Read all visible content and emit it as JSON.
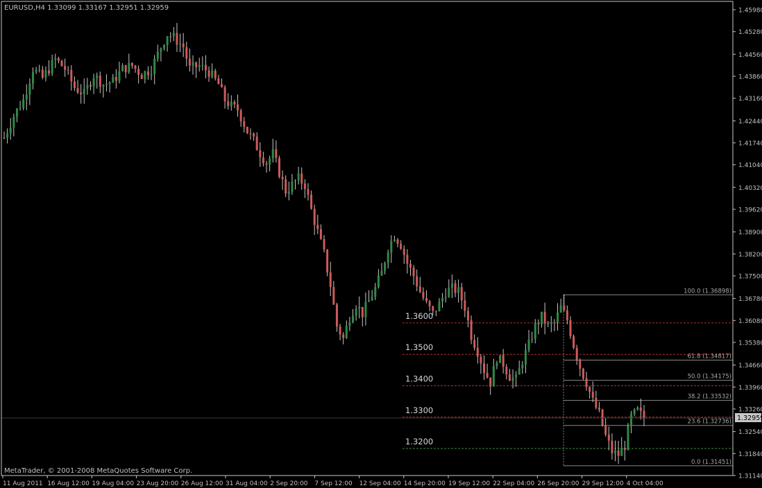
{
  "symbol_header": "EURUSD,H4  1.33099 1.33167 1.32951 1.32959",
  "footer": "MetaTrader, © 2001-2008 MetaQuotes Software Corp.",
  "colors": {
    "background": "#000000",
    "frame": "#c8c8c8",
    "bull": "#2e8b46",
    "bear": "#d05a5a",
    "wick": "#c8c8c8",
    "grid": "#1a1a1a",
    "level_red": "#b03030",
    "level_green": "#3c8c3c",
    "fib": "#8a8a8a",
    "text": "#c0c0c0",
    "current_price_bg": "#c8c8c8"
  },
  "chart_data": {
    "type": "candlestick",
    "timeframe": "H4",
    "ylim": [
      1.3114,
      1.4598
    ],
    "y_ticks": [
      "1.45980",
      "1.45280",
      "1.44560",
      "1.43860",
      "1.43160",
      "1.42440",
      "1.41740",
      "1.41040",
      "1.40320",
      "1.39620",
      "1.38900",
      "1.38200",
      "1.37500",
      "1.36780",
      "1.36080",
      "1.35380",
      "1.34660",
      "1.33960",
      "1.33260",
      "1.32540",
      "1.31840",
      "1.31140"
    ],
    "x_ticks": [
      "11 Aug 2011",
      "16 Aug 12:00",
      "19 Aug 04:00",
      "23 Aug 20:00",
      "26 Aug 12:00",
      "31 Aug 04:00",
      "2 Sep 20:00",
      "7 Sep 12:00",
      "12 Sep 04:00",
      "14 Sep 20:00",
      "19 Sep 12:00",
      "22 Sep 04:00",
      "26 Sep 20:00",
      "29 Sep 12:00",
      "4 Oct 04:00"
    ],
    "current_price": "1.32959",
    "current_price_value": 1.32959,
    "anchors": [
      [
        0,
        1.419
      ],
      [
        3,
        1.426
      ],
      [
        6,
        1.431
      ],
      [
        9,
        1.441
      ],
      [
        12,
        1.438
      ],
      [
        16,
        1.444
      ],
      [
        19,
        1.441
      ],
      [
        22,
        1.435
      ],
      [
        25,
        1.433
      ],
      [
        28,
        1.439
      ],
      [
        31,
        1.436
      ],
      [
        34,
        1.437
      ],
      [
        37,
        1.441
      ],
      [
        40,
        1.442
      ],
      [
        43,
        1.439
      ],
      [
        46,
        1.441
      ],
      [
        49,
        1.448
      ],
      [
        51,
        1.452
      ],
      [
        53,
        1.451
      ],
      [
        56,
        1.448
      ],
      [
        58,
        1.441
      ],
      [
        61,
        1.442
      ],
      [
        64,
        1.44
      ],
      [
        67,
        1.436
      ],
      [
        69,
        1.431
      ],
      [
        71,
        1.429
      ],
      [
        73,
        1.428
      ],
      [
        76,
        1.421
      ],
      [
        78,
        1.418
      ],
      [
        80,
        1.414
      ],
      [
        82,
        1.411
      ],
      [
        84,
        1.414
      ],
      [
        86,
        1.408
      ],
      [
        88,
        1.402
      ],
      [
        90,
        1.404
      ],
      [
        92,
        1.406
      ],
      [
        94,
        1.404
      ],
      [
        96,
        1.396
      ],
      [
        98,
        1.389
      ],
      [
        100,
        1.382
      ],
      [
        102,
        1.372
      ],
      [
        104,
        1.359
      ],
      [
        106,
        1.355
      ],
      [
        108,
        1.362
      ],
      [
        110,
        1.366
      ],
      [
        112,
        1.363
      ],
      [
        114,
        1.367
      ],
      [
        116,
        1.371
      ],
      [
        118,
        1.376
      ],
      [
        120,
        1.384
      ],
      [
        122,
        1.388
      ],
      [
        124,
        1.385
      ],
      [
        126,
        1.379
      ],
      [
        128,
        1.375
      ],
      [
        130,
        1.37
      ],
      [
        132,
        1.366
      ],
      [
        134,
        1.363
      ],
      [
        136,
        1.366
      ],
      [
        138,
        1.37
      ],
      [
        140,
        1.371
      ],
      [
        142,
        1.37
      ],
      [
        144,
        1.365
      ],
      [
        146,
        1.356
      ],
      [
        148,
        1.351
      ],
      [
        150,
        1.345
      ],
      [
        152,
        1.341
      ],
      [
        154,
        1.349
      ],
      [
        156,
        1.347
      ],
      [
        158,
        1.343
      ],
      [
        160,
        1.342
      ],
      [
        162,
        1.348
      ],
      [
        164,
        1.353
      ],
      [
        166,
        1.359
      ],
      [
        168,
        1.362
      ],
      [
        170,
        1.359
      ],
      [
        172,
        1.36
      ],
      [
        174,
        1.365
      ],
      [
        176,
        1.361
      ],
      [
        178,
        1.353
      ],
      [
        180,
        1.346
      ],
      [
        182,
        1.341
      ],
      [
        184,
        1.335
      ],
      [
        186,
        1.331
      ],
      [
        188,
        1.324
      ],
      [
        190,
        1.319
      ],
      [
        192,
        1.318
      ],
      [
        194,
        1.321
      ],
      [
        196,
        1.33
      ],
      [
        198,
        1.332
      ],
      [
        200,
        1.3296
      ]
    ],
    "horizontal_levels": [
      {
        "label": "1.3600",
        "value": 1.36,
        "color": "red"
      },
      {
        "label": "1.3500",
        "value": 1.35,
        "color": "red"
      },
      {
        "label": "1.3400",
        "value": 1.34,
        "color": "red"
      },
      {
        "label": "1.3300",
        "value": 1.33,
        "color": "red"
      },
      {
        "label": "1.3200",
        "value": 1.32,
        "color": "green"
      }
    ],
    "fibonacci": [
      {
        "label": "100.0 (1.36898)",
        "value": 1.36898
      },
      {
        "label": "61.8 (1.34817)",
        "value": 1.34817
      },
      {
        "label": "50.0 (1.34175)",
        "value": 1.34175
      },
      {
        "label": "38.2 (1.33532)",
        "value": 1.33532
      },
      {
        "label": "23.6 (1.32736)",
        "value": 1.32736
      },
      {
        "label": "0.0 (1.31451)",
        "value": 1.31451
      }
    ]
  }
}
